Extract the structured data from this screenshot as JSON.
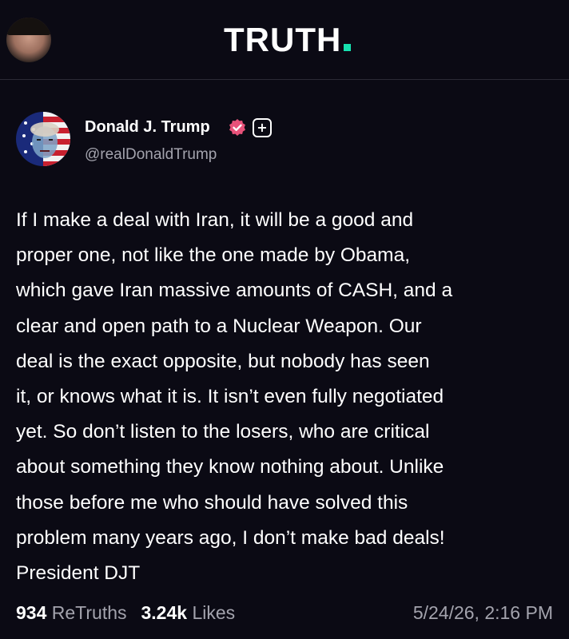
{
  "app": {
    "logo_text": "TRUTH",
    "accent_color": "#17e2b0"
  },
  "viewer": {
    "avatar_icon": "user-avatar"
  },
  "post": {
    "author_name": "Donald J. Trump",
    "author_handle": "@realDonaldTrump",
    "verified_icon": "verified-badge-icon",
    "plus_icon": "plus-badge-icon",
    "plus_symbol": "+",
    "body": "If I make a deal with Iran, it will be a good and\nproper one, not like the one made by Obama,\nwhich gave Iran massive amounts of CASH, and a\nclear and open path to a Nuclear Weapon. Our\ndeal is the exact opposite, but nobody has seen\nit, or knows what it is. It isn’t even fully negotiated\nyet. So don’t listen to the losers, who are critical\nabout something they know nothing about. Unlike\nthose before me who should have solved this\nproblem many years ago, I don’t make bad deals!\nPresident DJT",
    "retruths_count": "934",
    "retruths_label": "ReTruths",
    "likes_count": "3.24k",
    "likes_label": "Likes",
    "timestamp": "5/24/26, 2:16 PM",
    "verified_color": "#e8527a"
  }
}
